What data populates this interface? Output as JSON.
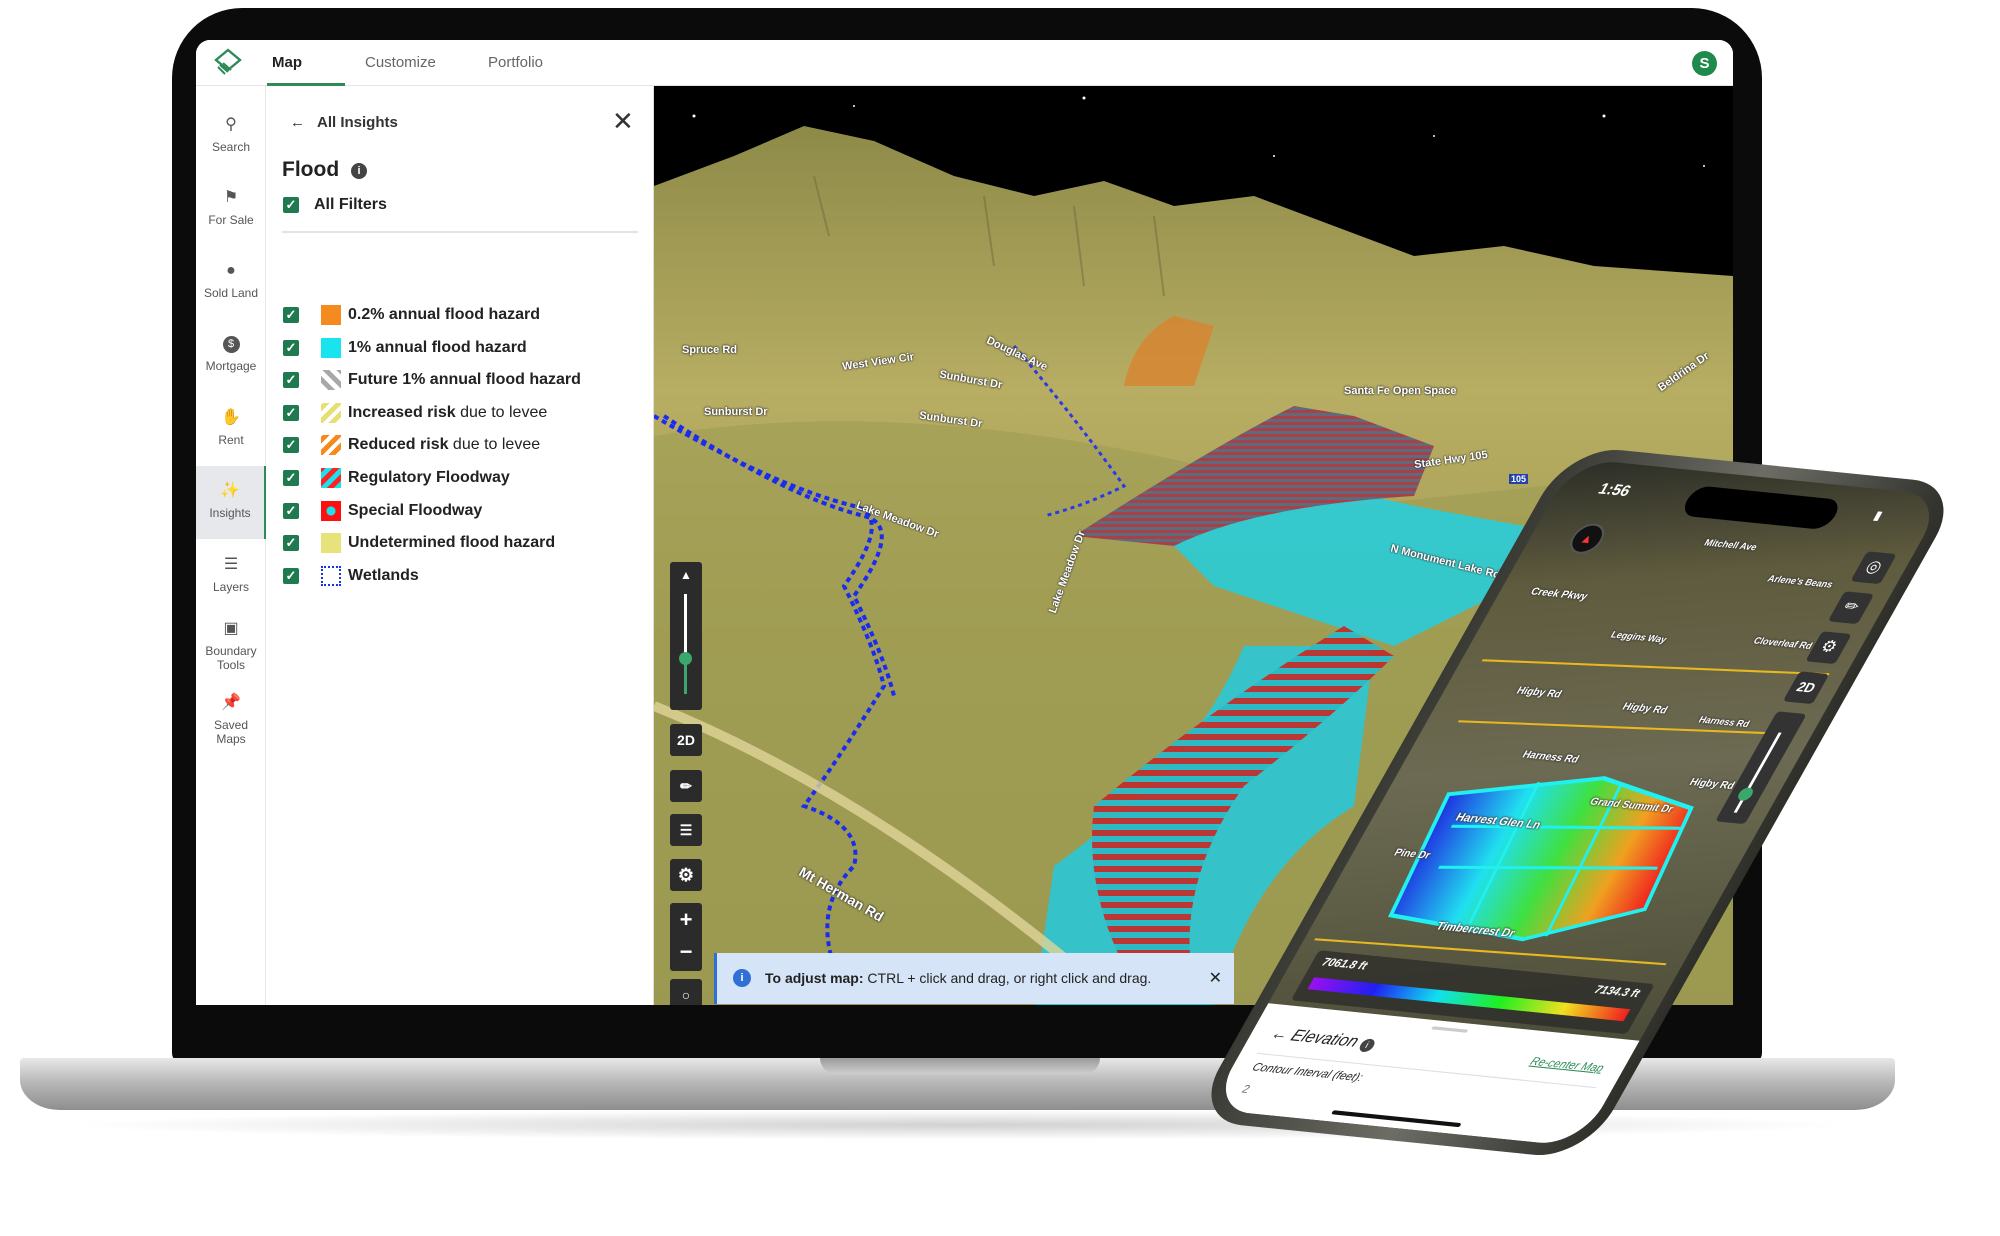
{
  "app": {
    "tabs": [
      {
        "label": "Map",
        "active": true
      },
      {
        "label": "Customize"
      },
      {
        "label": "Portfolio"
      }
    ],
    "avatar_initial": "S",
    "accent": "#1f7a4f"
  },
  "sidebar": {
    "items": [
      {
        "label": "Search",
        "icon": "search-icon"
      },
      {
        "label": "For Sale",
        "icon": "flag-icon"
      },
      {
        "label": "Sold Land",
        "icon": "map-pin-icon"
      },
      {
        "label": "Mortgage",
        "icon": "dollar-icon"
      },
      {
        "label": "Rent",
        "icon": "hand-dollar-icon"
      },
      {
        "label": "Insights",
        "icon": "sparkle-chart-icon",
        "active": true
      },
      {
        "label": "Layers",
        "icon": "layers-icon"
      },
      {
        "label": "Boundary Tools",
        "icon": "boundary-icon"
      },
      {
        "label": "Saved Maps",
        "icon": "pin-icon"
      }
    ]
  },
  "panel": {
    "back_label": "All Insights",
    "title": "Flood",
    "all_filters": "All Filters",
    "filters": [
      {
        "bold": "0.2% annual flood hazard",
        "rest": "",
        "color": "#f58a1f",
        "checked": true
      },
      {
        "bold": "1% annual flood hazard",
        "rest": "",
        "color": "#19e3ec",
        "checked": true
      },
      {
        "bold": "Future 1% annual flood hazard",
        "rest": "",
        "color": "#a8a8a8",
        "checked": true
      },
      {
        "bold": "Increased risk",
        "rest": " due to levee",
        "color": "#e6e072",
        "checked": true
      },
      {
        "bold": "Reduced risk",
        "rest": " due to levee",
        "color": "#f58a1f",
        "checked": true
      },
      {
        "bold": "Regulatory Floodway",
        "rest": "",
        "color": "#ff2222",
        "checked": true
      },
      {
        "bold": "Special Floodway",
        "rest": "",
        "color": "#ff1010",
        "checked": true
      },
      {
        "bold": "Undetermined flood hazard",
        "rest": "",
        "color": "#e8e27a",
        "checked": true
      },
      {
        "bold": "Wetlands",
        "rest": "",
        "color": "#1133ee",
        "checked": true
      }
    ]
  },
  "map": {
    "controls": {
      "two_d": "2D"
    },
    "banner": {
      "bold": "To adjust map:",
      "text": " CTRL + click and drag, or right click and drag."
    },
    "roads": [
      "Spruce Rd",
      "West View Cir",
      "Douglas Ave",
      "Sunburst Dr",
      "Sunburst Dr",
      "Sunburst Dr",
      "Santa Fe Open Space",
      "Beldrina Dr",
      "State Hwy 105",
      "105",
      "Lake Meadow Dr",
      "Lake Meadow Dr",
      "N Monument Lake Rd",
      "Mt Herman Rd"
    ]
  },
  "phone": {
    "time": "1:56",
    "roads": [
      "Mitchell Ave",
      "Arlene's Beans",
      "Creek Pkwy",
      "Leggins Way",
      "Cloverleaf Rd",
      "Higby Rd",
      "Higby Rd",
      "Harness Rd",
      "Harness Rd",
      "Higby Rd",
      "Grand Summit Dr",
      "Harvest Glen Ln",
      "Pine Dr",
      "Timbercrest Dr"
    ],
    "two_d": "2D",
    "elev_min": "7061.8 ft",
    "elev_max": "7134.3 ft",
    "sheet_title": "Elevation",
    "recenter": "Re-center Map",
    "contour_label": "Contour Interval (feet):",
    "contour_value": "2"
  }
}
